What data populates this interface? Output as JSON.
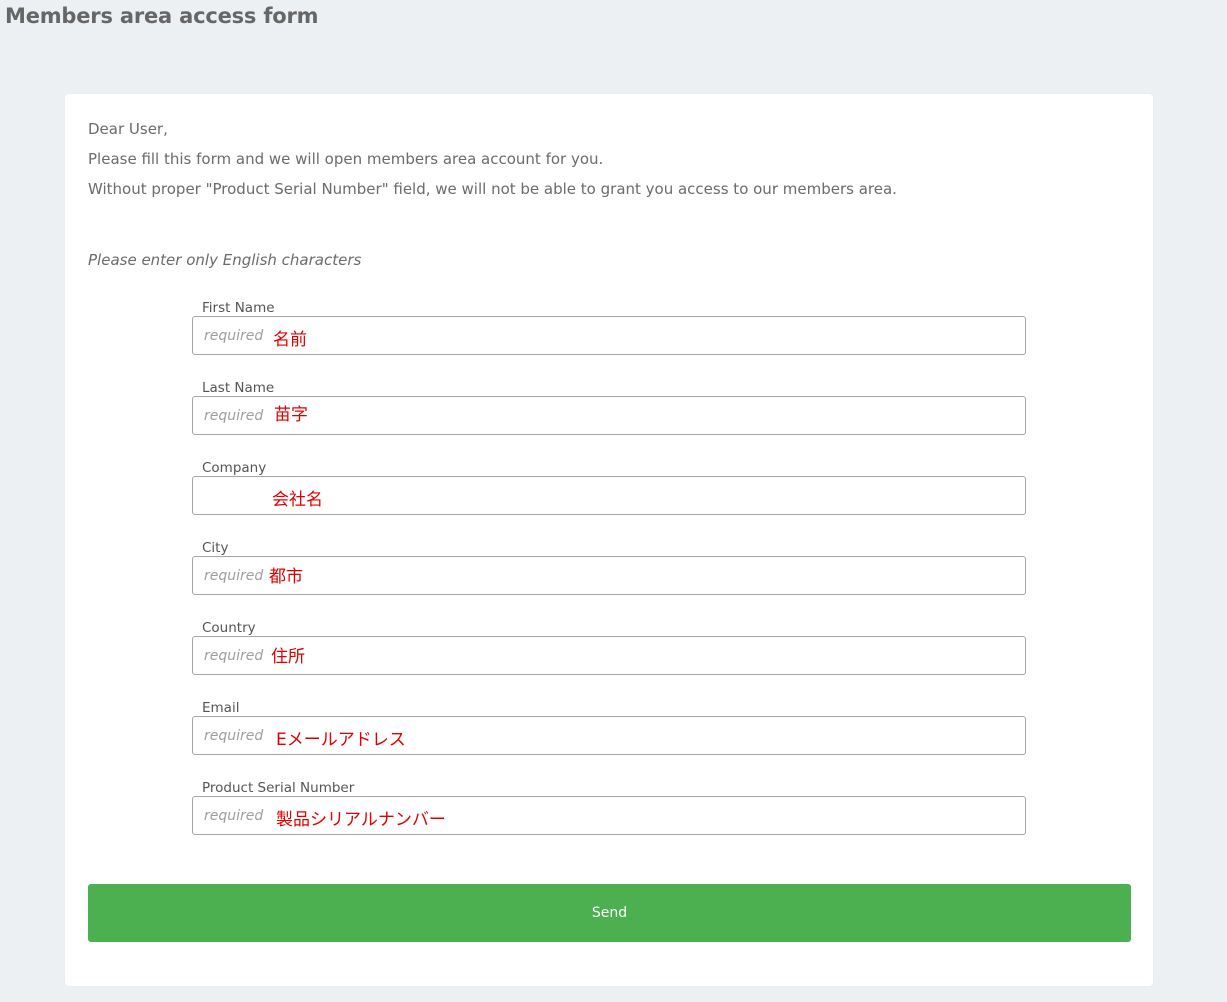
{
  "page": {
    "title": "Members area access form"
  },
  "intro": {
    "greeting": "Dear User,",
    "line1": "Please fill this form and we will open members area account for you.",
    "line2": "Without proper \"Product Serial Number\" field, we will not be able to grant you access to our members area."
  },
  "note": "Please enter only English characters",
  "fields": [
    {
      "label": "First Name",
      "placeholder": "required",
      "value": "",
      "annotation": "名前"
    },
    {
      "label": "Last Name",
      "placeholder": "required",
      "value": "",
      "annotation": "苗字"
    },
    {
      "label": "Company",
      "placeholder": "",
      "value": "",
      "annotation": "会社名"
    },
    {
      "label": "City",
      "placeholder": "required",
      "value": "",
      "annotation": "都市"
    },
    {
      "label": "Country",
      "placeholder": "required",
      "value": "",
      "annotation": "住所"
    },
    {
      "label": "Email",
      "placeholder": "required",
      "value": "",
      "annotation": "Eメールアドレス"
    },
    {
      "label": "Product Serial Number",
      "placeholder": "required",
      "value": "",
      "annotation": "製品シリアルナンバー"
    }
  ],
  "send_label": "Send",
  "colors": {
    "background": "#edf0f3",
    "card": "#ffffff",
    "button": "#4caf50",
    "annotation": "#e00000"
  }
}
